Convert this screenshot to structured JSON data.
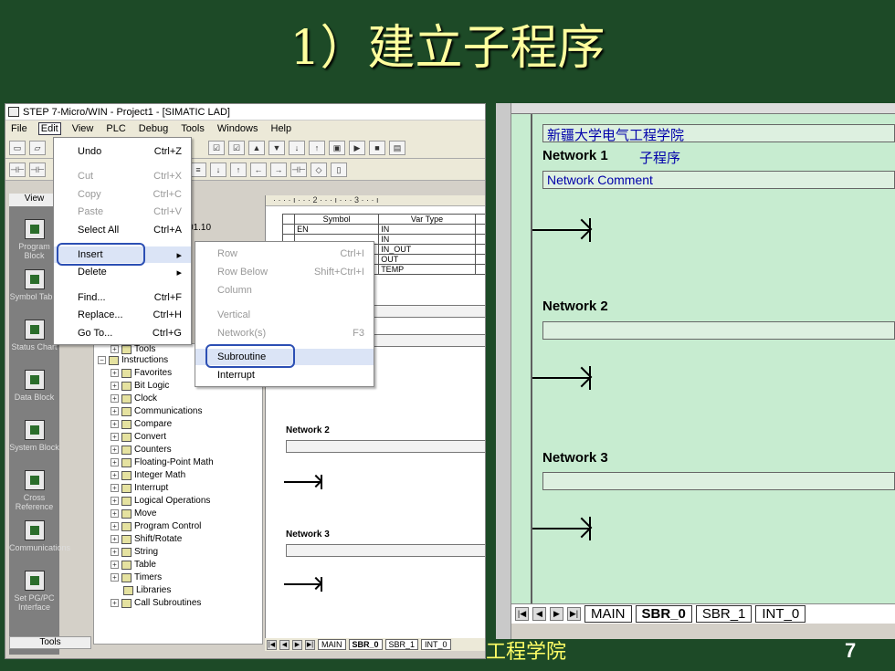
{
  "slide": {
    "title": "1）建立子程序",
    "footer": "工程学院",
    "page": "7"
  },
  "window": {
    "title": "STEP 7-Micro/WIN - Project1 - [SIMATIC LAD]",
    "menubar": [
      "File",
      "Edit",
      "View",
      "PLC",
      "Debug",
      "Tools",
      "Windows",
      "Help"
    ],
    "view_label": "View",
    "version_text": "01.10"
  },
  "edit_menu": [
    {
      "label": "Undo",
      "shortcut": "Ctrl+Z"
    },
    {
      "label": "Cut",
      "shortcut": "Ctrl+X"
    },
    {
      "label": "Copy",
      "shortcut": "Ctrl+C"
    },
    {
      "label": "Paste",
      "shortcut": "Ctrl+V"
    },
    {
      "label": "Select All",
      "shortcut": "Ctrl+A"
    },
    {
      "label": "Insert",
      "shortcut": "▸"
    },
    {
      "label": "Delete",
      "shortcut": "▸"
    },
    {
      "label": "Find...",
      "shortcut": "Ctrl+F"
    },
    {
      "label": "Replace...",
      "shortcut": "Ctrl+H"
    },
    {
      "label": "Go To...",
      "shortcut": "Ctrl+G"
    }
  ],
  "insert_menu": [
    {
      "label": "Row",
      "shortcut": "Ctrl+I"
    },
    {
      "label": "Row Below",
      "shortcut": "Shift+Ctrl+I"
    },
    {
      "label": "Column",
      "shortcut": ""
    },
    {
      "label": "Vertical",
      "shortcut": ""
    },
    {
      "label": "Network(s)",
      "shortcut": "F3"
    },
    {
      "label": "Subroutine",
      "shortcut": ""
    },
    {
      "label": "Interrupt",
      "shortcut": ""
    }
  ],
  "nav": [
    "Program Block",
    "Symbol Table",
    "Status Chart",
    "Data Block",
    "System Block",
    "Cross Reference",
    "Communications",
    "Set PG/PC Interface"
  ],
  "nav_tools": "Tools",
  "tree": [
    "Tools",
    "Instructions",
    "Favorites",
    "Bit Logic",
    "Clock",
    "Communications",
    "Compare",
    "Convert",
    "Counters",
    "Floating-Point Math",
    "Integer Math",
    "Interrupt",
    "Logical Operations",
    "Move",
    "Program Control",
    "Shift/Rotate",
    "String",
    "Table",
    "Timers",
    "Libraries",
    "Call Subroutines"
  ],
  "var_table": {
    "headers": [
      "Symbol",
      "Var Type"
    ],
    "rows": [
      [
        "EN",
        "IN"
      ],
      [
        "",
        "IN"
      ],
      [
        "",
        "IN_OUT"
      ],
      [
        "",
        "OUT"
      ],
      [
        "",
        "TEMP"
      ]
    ]
  },
  "editor": {
    "ruler": "· · · · ı · · · 2 · · · ı · · · 3 · · · ı",
    "network2": "Network 2",
    "network3": "Network 3"
  },
  "tabs": [
    "MAIN",
    "SBR_0",
    "SBR_1",
    "INT_0"
  ],
  "right_panel": {
    "title_comment": "新疆大学电气工程学院",
    "network1": "Network 1",
    "subroutine_label": "子程序",
    "network_comment": "Network Comment",
    "network2": "Network 2",
    "network3": "Network 3",
    "tabs": [
      "MAIN",
      "SBR_0",
      "SBR_1",
      "INT_0"
    ]
  }
}
